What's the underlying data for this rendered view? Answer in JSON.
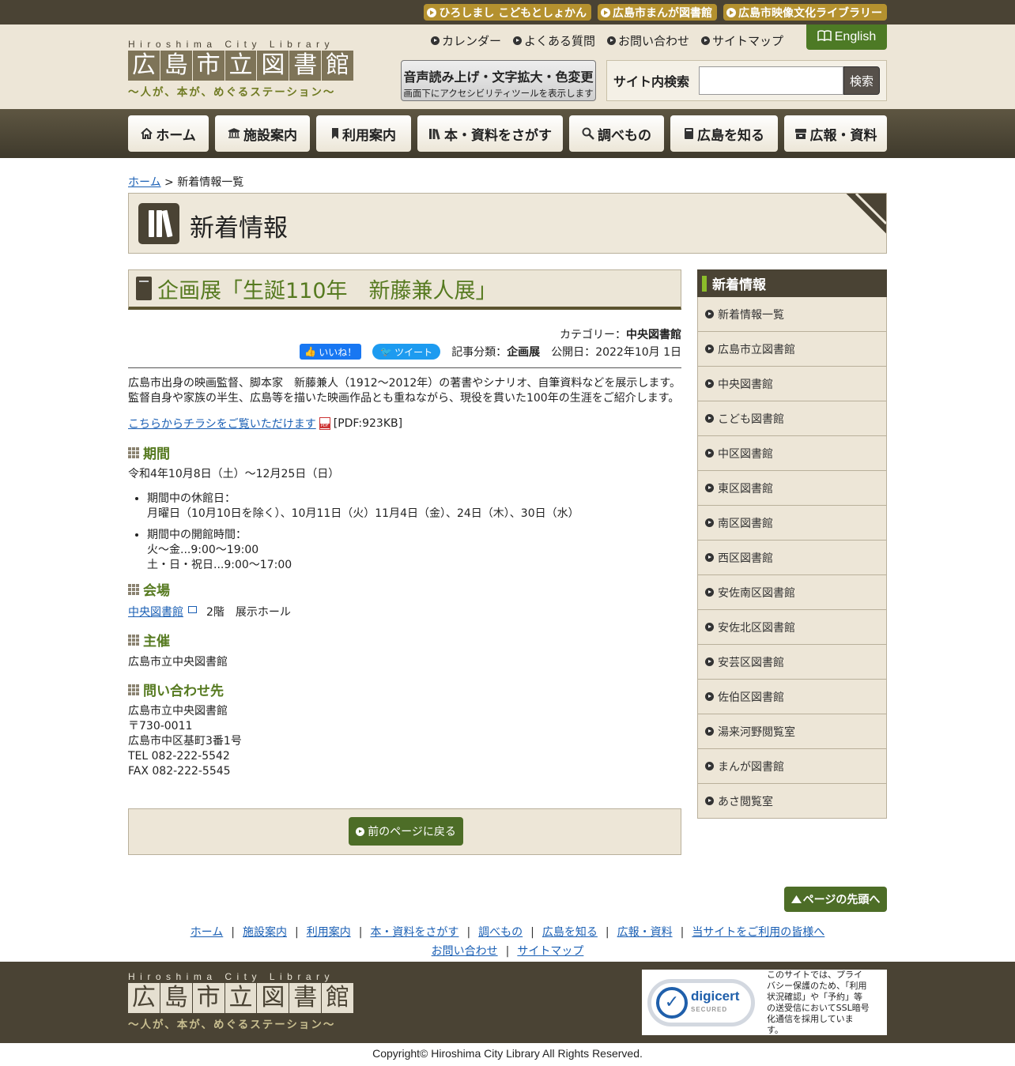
{
  "toplinks": [
    "ひろしまし こどもとしょかん",
    "広島市まんが図書館",
    "広島市映像文化ライブラリー"
  ],
  "logo": {
    "en": "Hiroshima City Library",
    "jp": [
      "広",
      "島",
      "市",
      "立",
      "図",
      "書",
      "館"
    ],
    "tagline": "〜人が、本が、めぐるステーション〜"
  },
  "utilnav": [
    "カレンダー",
    "よくある質問",
    "お問い合わせ",
    "サイトマップ"
  ],
  "english": "English",
  "accessibility": {
    "line1": "音声読み上げ・文字拡大・色変更",
    "line2": "画面下にアクセシビリティツールを表示します"
  },
  "search": {
    "label": "サイト内検索",
    "placeholder": "",
    "button": "検索"
  },
  "gnav": [
    {
      "label": "ホーム",
      "icon": "home-icon"
    },
    {
      "label": "施設案内",
      "icon": "building-icon"
    },
    {
      "label": "利用案内",
      "icon": "bookmark-icon"
    },
    {
      "label": "本・資料をさがす",
      "icon": "books-icon"
    },
    {
      "label": "調べもの",
      "icon": "magnifier-icon"
    },
    {
      "label": "広島を知る",
      "icon": "book-icon"
    },
    {
      "label": "広報・資料",
      "icon": "archive-icon"
    }
  ],
  "breadcrumb": {
    "home": "ホーム",
    "sep": " > ",
    "current": "新着情報一覧"
  },
  "page_title": "新着情報",
  "article": {
    "title": "企画展「生誕110年　新藤兼人展」",
    "category_label": "カテゴリー：",
    "category": "中央図書館",
    "fb": "いいね！",
    "tweet": "ツイート",
    "type_label": "記事分類：",
    "type": "企画展",
    "date_label": "公開日：",
    "date": "2022年10月 1日",
    "intro1": "広島市出身の映画監督、脚本家　新藤兼人（1912～2012年）の著書やシナリオ、自筆資料などを展示します。",
    "intro2": "監督自身や家族の半生、広島等を描いた映画作品とも重ねながら、現役を貫いた100年の生涯をご紹介します。",
    "pdf_link": "こちらからチラシをご覧いただけます",
    "pdf_size": "[PDF:923KB]",
    "h_period": "期間",
    "period": "令和4年10月8日（土）～12月25日（日）",
    "closed_label": "期間中の休館日：",
    "closed": "月曜日（10月10日を除く）、10月11日（火）11月4日（金）、24日（木）、30日（水）",
    "hours_label": "期間中の開館時間：",
    "hours1": "火～金...9:00～19:00",
    "hours2": "土・日・祝日...9:00～17:00",
    "h_venue": "会場",
    "venue_link": "中央図書館",
    "venue_rest": "2階　展示ホール",
    "h_host": "主催",
    "host": "広島市立中央図書館",
    "h_contact": "問い合わせ先",
    "contact": [
      "広島市立中央図書館",
      "〒730-0011",
      "広島市中区基町3番1号",
      "TEL 082-222-5542",
      "FAX 082-222-5545"
    ],
    "back": "前のページに戻る"
  },
  "sidebar": {
    "title": "新着情報",
    "items": [
      "新着情報一覧",
      "広島市立図書館",
      "中央図書館",
      "こども図書館",
      "中区図書館",
      "東区図書館",
      "南区図書館",
      "西区図書館",
      "安佐南区図書館",
      "安佐北区図書館",
      "安芸区図書館",
      "佐伯区図書館",
      "湯来河野閲覧室",
      "まんが図書館",
      "あさ閲覧室"
    ]
  },
  "totop": "ページの先頭へ",
  "footnav1": [
    "ホーム",
    "施設案内",
    "利用案内",
    "本・資料をさがす",
    "調べもの",
    "広島を知る",
    "広報・資料",
    "当サイトをご利用の皆様へ"
  ],
  "footnav2": [
    "お問い合わせ",
    "サイトマップ"
  ],
  "ssl": {
    "brand": "digicert",
    "secured": "SECURED",
    "text": "このサイトでは、プライバシー保護のため、「利用状況確認」や「予約」等の送受信においてSSL暗号化通信を採用しています。"
  },
  "copyright": "Copyright© Hiroshima City Library All Rights Reserved."
}
